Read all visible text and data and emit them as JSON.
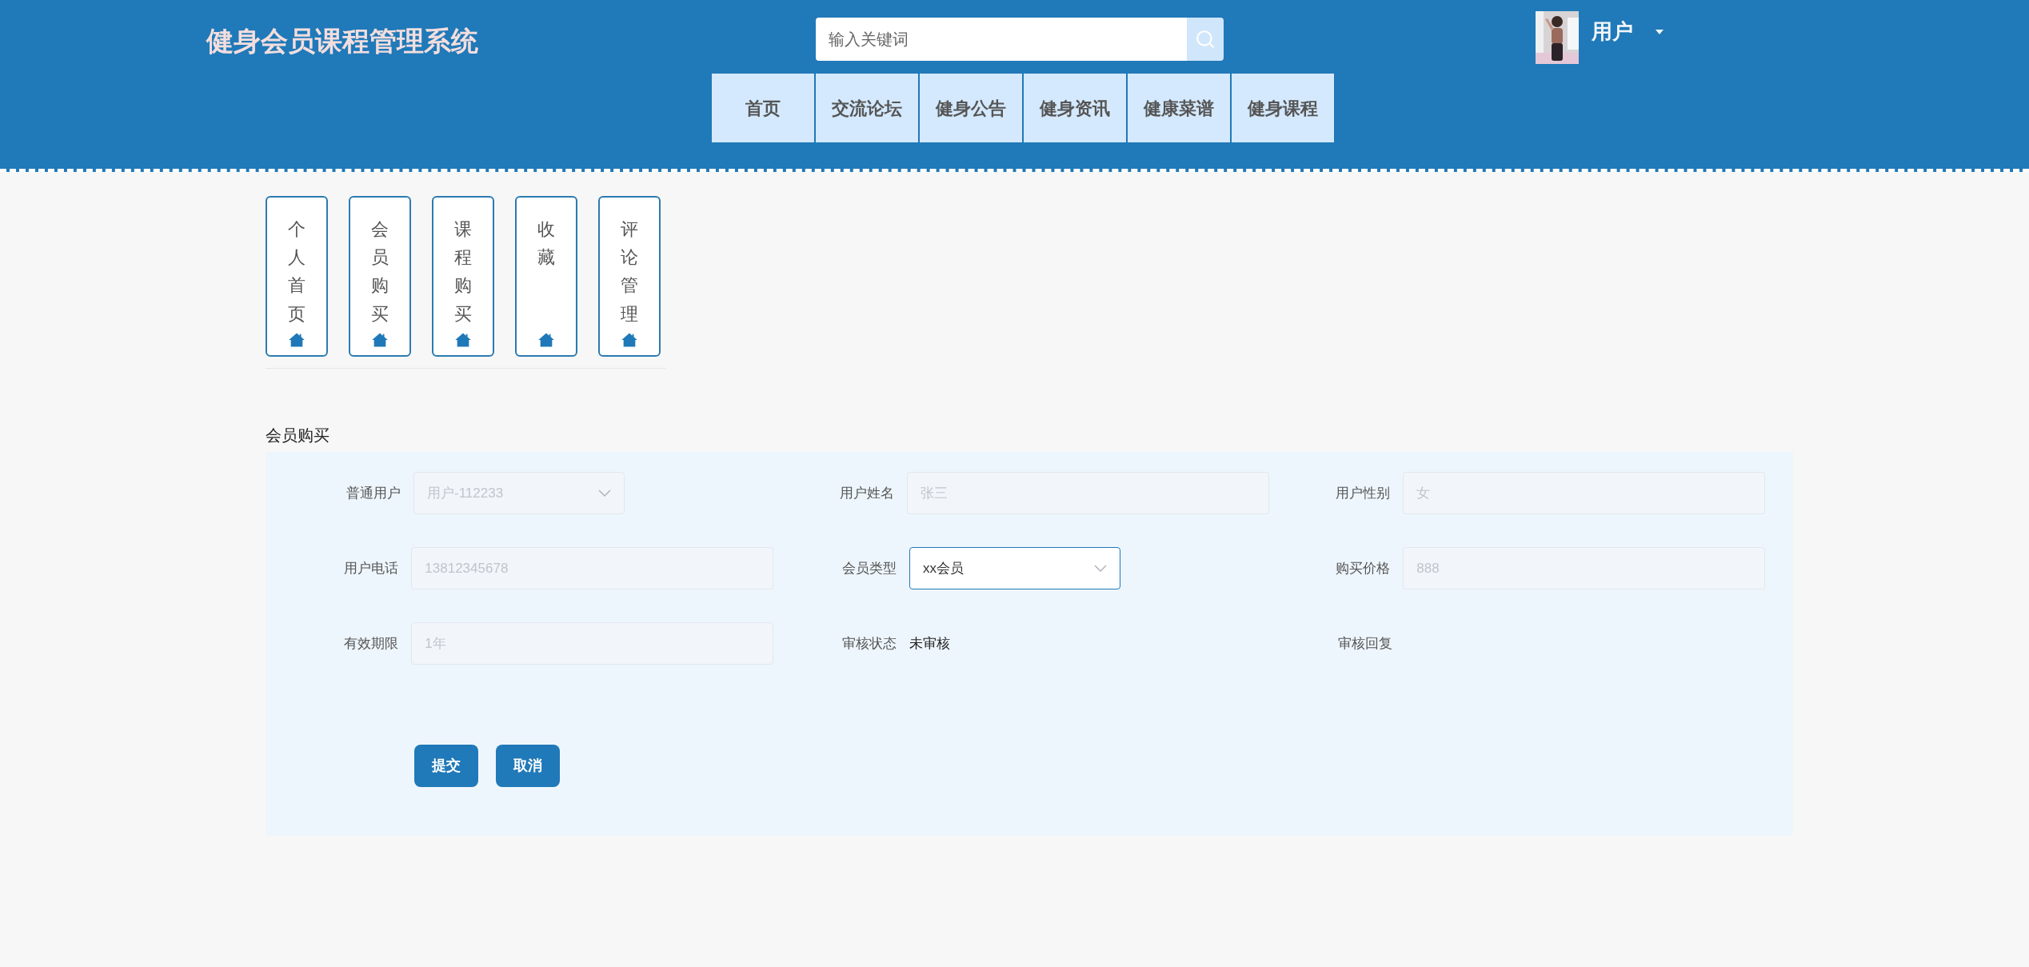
{
  "header": {
    "title": "健身会员课程管理系统",
    "search": {
      "placeholder": "输入关键词"
    },
    "user": {
      "name": "用户"
    }
  },
  "nav": [
    {
      "label": "首页"
    },
    {
      "label": "交流论坛"
    },
    {
      "label": "健身公告"
    },
    {
      "label": "健身资讯"
    },
    {
      "label": "健康菜谱"
    },
    {
      "label": "健身课程"
    }
  ],
  "side_tiles": [
    {
      "label": "个人首页"
    },
    {
      "label": "会员购买"
    },
    {
      "label": "课程购买"
    },
    {
      "label": "收藏"
    },
    {
      "label": "评论管理"
    }
  ],
  "form": {
    "title": "会员购买",
    "fields": [
      {
        "label": "普通用户",
        "kind": "select",
        "value": "用户-112233",
        "disabled": true
      },
      {
        "label": "用户姓名",
        "kind": "input",
        "value": "张三",
        "disabled": true
      },
      {
        "label": "用户性别",
        "kind": "input",
        "value": "女",
        "disabled": true
      },
      {
        "label": "用户电话",
        "kind": "input",
        "value": "13812345678",
        "disabled": true
      },
      {
        "label": "会员类型",
        "kind": "select",
        "value": "xx会员",
        "disabled": false
      },
      {
        "label": "购买价格",
        "kind": "input",
        "value": "888",
        "disabled": true
      },
      {
        "label": "有效期限",
        "kind": "input",
        "value": "1年",
        "disabled": true
      },
      {
        "label": "审核状态",
        "kind": "text",
        "value": "未审核"
      },
      {
        "label": "审核回复",
        "kind": "text"
      }
    ],
    "buttons": [
      "提交",
      "取消"
    ]
  }
}
